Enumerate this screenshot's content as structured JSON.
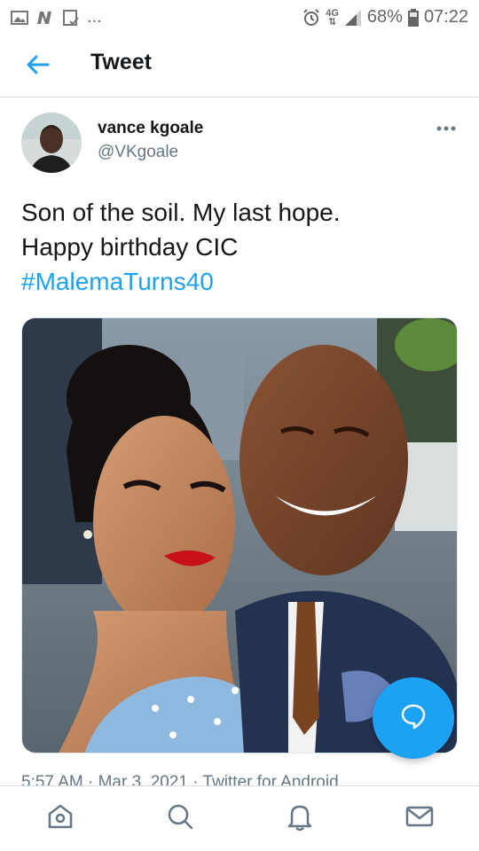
{
  "status_bar": {
    "network": "4G",
    "battery": "68%",
    "time": "07:22",
    "more": "..."
  },
  "header": {
    "title": "Tweet",
    "back_icon": "arrow-left-icon"
  },
  "tweet": {
    "author_name": "vance kgoale",
    "author_handle": "@VKgoale",
    "text_line_1": "Son of the soil. My last hope.",
    "text_line_2": "Happy birthday CIC",
    "hashtag": "#MalemaTurns40",
    "meta": "5:57 AM · Mar 3, 2021 · Twitter for Android"
  },
  "bottom_nav": {
    "items": [
      "home-icon",
      "search-icon",
      "notifications-icon",
      "messages-icon"
    ]
  },
  "colors": {
    "accent": "#1da1f2",
    "secondary_text": "#657786",
    "primary_text": "#14171a"
  }
}
